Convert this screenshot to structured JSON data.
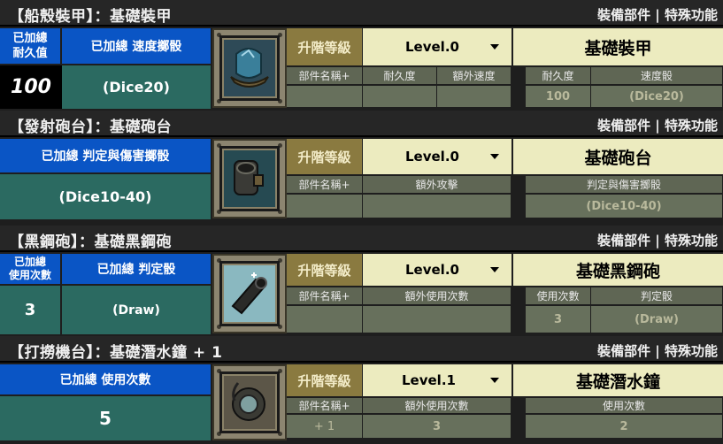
{
  "sections": [
    {
      "title": "【船殼裝甲】：基礎裝甲",
      "right": "裝備部件 | 特殊功能",
      "stat_labels": [
        "已加總",
        "耐久值"
      ],
      "dice_label": "已加總  速度擲骰",
      "stat_value": "100",
      "dice_value": "(Dice20)",
      "upgrade_label": "升階等級",
      "level": "Level.0",
      "part_name": "基礎裝甲",
      "cols": [
        "部件名稱+",
        "耐久度",
        "額外速度",
        "耐久度",
        "速度骰"
      ],
      "vals": [
        "",
        "",
        "",
        "100",
        "(Dice20)"
      ]
    },
    {
      "title": "【發射砲台】：基礎砲台",
      "right": "裝備部件 | 特殊功能",
      "dice_label": "已加總  判定與傷害擲骰",
      "dice_value": "(Dice10-40)",
      "upgrade_label": "升階等級",
      "level": "Level.0",
      "part_name": "基礎砲台",
      "cols": [
        "部件名稱+",
        "額外攻擊",
        "判定與傷害擲骰"
      ],
      "vals": [
        "",
        "",
        "(Dice10-40)"
      ]
    },
    {
      "title": "【黑鋼砲】：基礎黑鋼砲",
      "right": "裝備部件 | 特殊功能",
      "stat_labels": [
        "已加總",
        "使用次數"
      ],
      "dice_label": "已加總    判定骰",
      "stat_value": "3",
      "dice_value": "(Draw)",
      "upgrade_label": "升階等級",
      "level": "Level.0",
      "part_name": "基礎黑鋼砲",
      "cols": [
        "部件名稱+",
        "額外使用次數",
        "使用次數",
        "判定骰"
      ],
      "vals": [
        "",
        "",
        "3",
        "(Draw)"
      ]
    },
    {
      "title": "【打撈機台】：基礎潛水鐘 + 1",
      "right": "裝備部件 | 特殊功能",
      "dice_label": "已加總  使用次數",
      "dice_value": "5",
      "upgrade_label": "升階等級",
      "level": "Level.1",
      "part_name": "基礎潛水鐘",
      "cols": [
        "部件名稱+",
        "額外使用次數",
        "使用次數"
      ],
      "vals": [
        "+ 1",
        "3",
        "2"
      ]
    }
  ]
}
